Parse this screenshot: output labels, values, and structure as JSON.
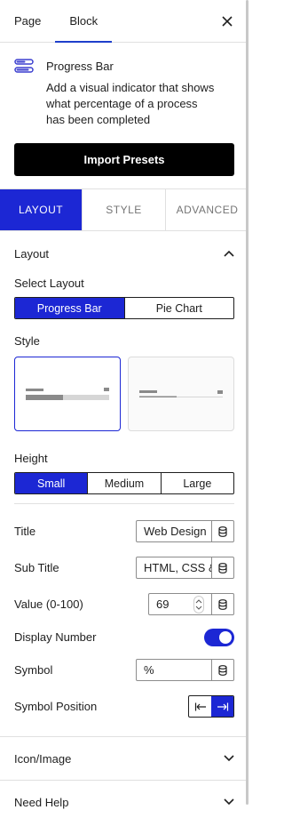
{
  "top_tabs": [
    {
      "label": "Page"
    },
    {
      "label": "Block"
    }
  ],
  "block": {
    "name": "Progress Bar",
    "description": "Add a visual indicator that shows what percentage of a process has been completed"
  },
  "import_button": "Import Presets",
  "panel_tabs": [
    {
      "label": "LAYOUT"
    },
    {
      "label": "STYLE"
    },
    {
      "label": "ADVANCED"
    }
  ],
  "layout_section": {
    "title": "Layout",
    "select_layout_label": "Select Layout",
    "layout_options": [
      "Progress Bar",
      "Pie Chart"
    ],
    "selected_layout": "Progress Bar",
    "style_label": "Style",
    "height_label": "Height",
    "height_options": [
      "Small",
      "Medium",
      "Large"
    ],
    "selected_height": "Small",
    "title_label": "Title",
    "title_value": "Web Design",
    "subtitle_label": "Sub Title",
    "subtitle_value": "HTML, CSS & JavaScript",
    "value_label": "Value (0-100)",
    "value": "69",
    "display_number_label": "Display Number",
    "display_number": true,
    "symbol_label": "Symbol",
    "symbol_value": "%",
    "symbol_position_label": "Symbol Position",
    "symbol_position": "after"
  },
  "collapsed_sections": [
    {
      "label": "Icon/Image"
    },
    {
      "label": "Need Help"
    }
  ],
  "colors": {
    "accent": "#1c27d4",
    "black": "#000000",
    "border": "#e0e0e0"
  },
  "icons": {
    "close": "close-icon",
    "block": "progress-bar-block-icon",
    "chevron_up": "chevron-up-icon",
    "chevron_down": "chevron-down-icon",
    "dynamic": "database-icon"
  }
}
